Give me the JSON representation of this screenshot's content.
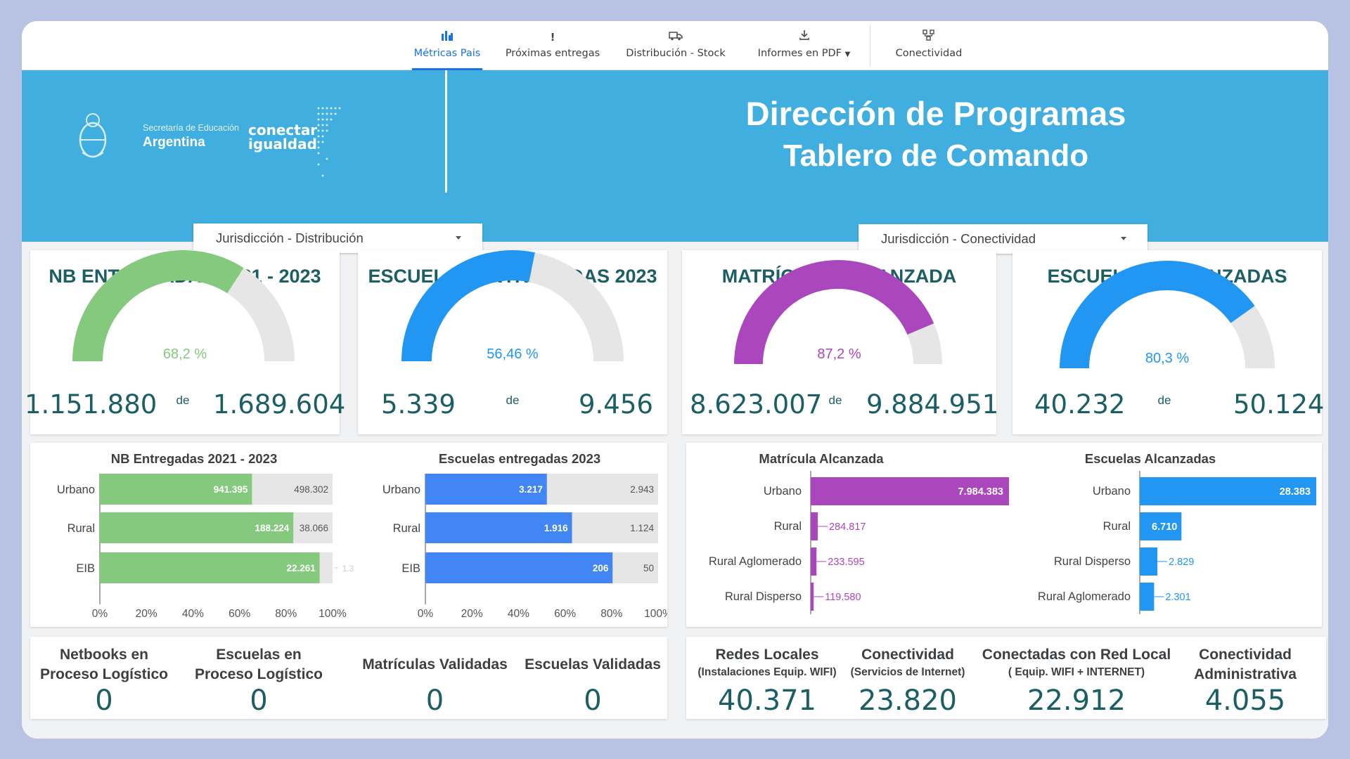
{
  "nav": {
    "tabs": [
      {
        "label": "Métricas Pais",
        "icon": "bar-chart-icon"
      },
      {
        "label": "Próximas entregas",
        "icon": "exclamation-icon"
      },
      {
        "label": "Distribución - Stock",
        "icon": "truck-icon"
      },
      {
        "label": "Informes en PDF",
        "icon": "download-icon"
      },
      {
        "label": "Conectividad",
        "icon": "network-icon"
      }
    ]
  },
  "header": {
    "logo_sec": "Secretaría de Educación",
    "logo_arg": "Argentina",
    "logo_ci_1": "conectar",
    "logo_ci_2": "igualdad",
    "title_1": "Dirección de Programas",
    "title_2": "Tablero de Comando",
    "dropdown_dist": "Jurisdicción - Distribución",
    "dropdown_con": "Jurisdicción - Conectividad"
  },
  "gauges": [
    {
      "title": "NB ENTREGADAS 2021 - 2023",
      "pct": "68,2 %",
      "fraction": 0.682,
      "current": "1.151.880",
      "de": "de",
      "total": "1.689.604",
      "color": "#85c97e"
    },
    {
      "title": "ESCUELAS ENTREGADAS 2023",
      "pct": "56,46 %",
      "fraction": 0.5646,
      "current": "5.339",
      "de": "de",
      "total": "9.456",
      "color": "#2196f3"
    },
    {
      "title": "MATRÍCULA ALCANZADA",
      "pct": "87,2 %",
      "fraction": 0.872,
      "current": "8.623.007",
      "de": "de",
      "total": "9.884.951",
      "color": "#ab47bc"
    },
    {
      "title": "ESCUELAS ALCANZADAS",
      "pct": "80,3 %",
      "fraction": 0.803,
      "current": "40.232",
      "de": "de",
      "total": "50.124",
      "color": "#2196f3"
    }
  ],
  "chart_data": [
    {
      "type": "bar",
      "title": "NB Entregadas 2021 - 2023",
      "categories": [
        "Urbano",
        "Rural",
        "EIB"
      ],
      "series": [
        {
          "values": [
            941395,
            188224,
            22261
          ],
          "labels": [
            "941.395",
            "188.224",
            "22.261"
          ],
          "color": "#85c97e"
        },
        {
          "values": [
            498302,
            38066,
            1300
          ],
          "labels": [
            "498.302",
            "38.066",
            "1.3"
          ],
          "color": "#e6e6e6"
        }
      ],
      "xticks": [
        "0%",
        "20%",
        "40%",
        "60%",
        "80%",
        "100%"
      ],
      "stacked_percent": true
    },
    {
      "type": "bar",
      "title": "Escuelas entregadas 2023",
      "categories": [
        "Urbano",
        "Rural",
        "EIB"
      ],
      "series": [
        {
          "values": [
            3217,
            1916,
            206
          ],
          "labels": [
            "3.217",
            "1.916",
            "206"
          ],
          "color": "#4285f4"
        },
        {
          "values": [
            2943,
            1124,
            50
          ],
          "labels": [
            "2.943",
            "1.124",
            "50"
          ],
          "color": "#e6e6e6"
        }
      ],
      "xticks": [
        "0%",
        "20%",
        "40%",
        "60%",
        "80%",
        "100%"
      ],
      "stacked_percent": true
    },
    {
      "type": "bar",
      "title": "Matrícula Alcanzada",
      "categories": [
        "Urbano",
        "Rural",
        "Rural Aglomerado",
        "Rural Disperso"
      ],
      "values": [
        7984383,
        284817,
        233595,
        119580
      ],
      "labels": [
        "7.984.383",
        "284.817",
        "233.595",
        "119.580"
      ],
      "color": "#ab47bc"
    },
    {
      "type": "bar",
      "title": "Escuelas Alcanzadas",
      "categories": [
        "Urbano",
        "Rural",
        "Rural Disperso",
        "Rural Aglomerado"
      ],
      "values": [
        28383,
        6710,
        2829,
        2301
      ],
      "labels": [
        "28.383",
        "6.710",
        "2.829",
        "2.301"
      ],
      "color": "#2196f3"
    }
  ],
  "stats_left": [
    {
      "label_1": "Netbooks en",
      "label_2": "Proceso Logístico",
      "value": "0"
    },
    {
      "label_1": "Escuelas en",
      "label_2": "Proceso Logístico",
      "value": "0"
    },
    {
      "label_1": "Matrículas Validadas",
      "value": "0"
    },
    {
      "label_1": "Escuelas Validadas",
      "value": "0"
    }
  ],
  "stats_right": [
    {
      "label_1": "Redes Locales",
      "sub": "(Instalaciones Equip. WIFI)",
      "value": "40.371"
    },
    {
      "label_1": "Conectividad",
      "sub": "(Servicios de Internet)",
      "value": "23.820"
    },
    {
      "label_1": "Conectadas con Red Local",
      "sub": "( Equip. WIFI + INTERNET)",
      "value": "22.912"
    },
    {
      "label_1": "Conectividad",
      "label_2": "Administrativa",
      "value": "4.055"
    }
  ]
}
